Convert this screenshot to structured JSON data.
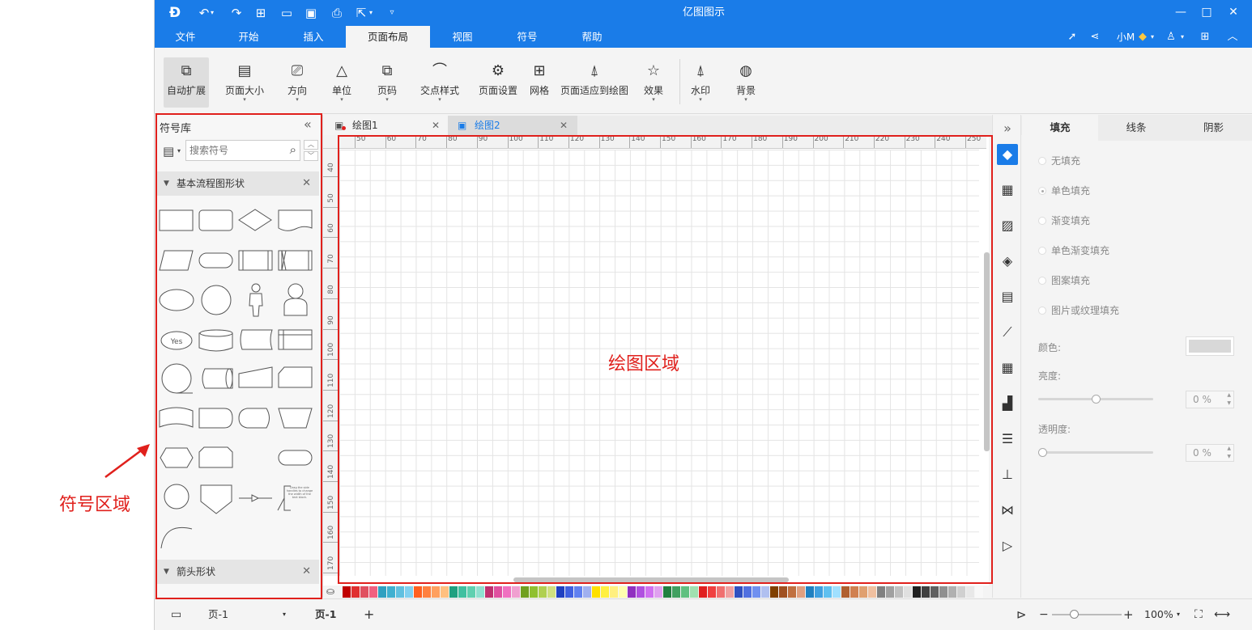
{
  "app": {
    "title": "亿图图示"
  },
  "menu": {
    "items": [
      "文件",
      "开始",
      "插入",
      "页面布局",
      "视图",
      "符号",
      "帮助"
    ],
    "active": "页面布局"
  },
  "account": {
    "user": "小M"
  },
  "ribbon": {
    "buttons": [
      {
        "label": "自动扩展",
        "icon": "auto-expand-icon",
        "has_caret": false
      },
      {
        "label": "页面大小",
        "icon": "page-size-icon",
        "has_caret": true
      },
      {
        "label": "方向",
        "icon": "orientation-icon",
        "has_caret": true
      },
      {
        "label": "单位",
        "icon": "unit-icon",
        "has_caret": true
      },
      {
        "label": "页码",
        "icon": "page-number-icon",
        "has_caret": true
      },
      {
        "label": "交点样式",
        "icon": "jump-style-icon",
        "has_caret": true
      },
      {
        "label": "页面设置",
        "icon": "page-setup-icon",
        "has_caret": false
      },
      {
        "label": "网格",
        "icon": "grid-icon",
        "has_caret": false
      },
      {
        "label": "页面适应到绘图",
        "icon": "fit-to-drawing-icon",
        "has_caret": false
      },
      {
        "label": "效果",
        "icon": "effect-icon",
        "has_caret": true
      },
      {
        "label": "水印",
        "icon": "watermark-icon",
        "has_caret": true
      },
      {
        "label": "背景",
        "icon": "background-icon",
        "has_caret": true
      }
    ]
  },
  "library": {
    "title": "符号库",
    "search_placeholder": "搜索符号",
    "sections": [
      {
        "label": "基本流程图形状"
      },
      {
        "label": "箭头形状"
      }
    ],
    "yes_shape_label": "Yes",
    "note_shape_text": "Drag the side handles to change the width of the text block."
  },
  "tabs": [
    {
      "label": "绘图1",
      "active": false
    },
    {
      "label": "绘图2",
      "active": true
    }
  ],
  "ruler": {
    "h_ticks": [
      "50",
      "60",
      "70",
      "80",
      "90",
      "100",
      "110",
      "120",
      "130",
      "140",
      "150",
      "160",
      "170",
      "180",
      "190",
      "200",
      "210",
      "220",
      "230",
      "240",
      "250"
    ],
    "v_ticks": [
      "40",
      "50",
      "60",
      "70",
      "80",
      "90",
      "100",
      "110",
      "120",
      "130",
      "140",
      "150",
      "160",
      "170"
    ]
  },
  "canvas": {
    "annotation_label": "绘图区域"
  },
  "annotation": {
    "symbol_area_label": "符号区域"
  },
  "fill_panel": {
    "tabs": [
      "填充",
      "线条",
      "阴影"
    ],
    "active_tab": "填充",
    "options": [
      "无填充",
      "单色填充",
      "渐变填充",
      "单色渐变填充",
      "图案填充",
      "图片或纹理填充"
    ],
    "selected": "单色填充",
    "color_label": "颜色:",
    "brightness_label": "亮度:",
    "brightness_value": "0 %",
    "brightness_level": 0.5,
    "transparency_label": "透明度:",
    "transparency_value": "0 %",
    "transparency_level": 0.0
  },
  "status": {
    "page_select": "页-1",
    "page_tab": "页-1",
    "add_page": "+",
    "zoom": "100%",
    "zoom_level": 0.25
  },
  "colors": {
    "accent": "#1a7ce8",
    "annotation_red": "#e0201c"
  },
  "palette": [
    "#c00000",
    "#e03030",
    "#e05060",
    "#f06080",
    "#30a0c0",
    "#40b0d0",
    "#60c0e0",
    "#80d0f0",
    "#ff6020",
    "#ff8040",
    "#ffa060",
    "#ffc080",
    "#20a080",
    "#40c0a0",
    "#60d0b0",
    "#90e0d0",
    "#c03070",
    "#e050a0",
    "#f070c0",
    "#f0a0d0",
    "#70a020",
    "#90c030",
    "#b0d050",
    "#d0e080",
    "#2040c0",
    "#4060e0",
    "#6080f0",
    "#a0b0f0",
    "#ffe000",
    "#fff040",
    "#fff080",
    "#ffffb0",
    "#9030c0",
    "#b050e0",
    "#d070f0",
    "#e0a0f0",
    "#208040",
    "#40a060",
    "#60c080",
    "#a0e0b0",
    "#e02020",
    "#f04040",
    "#f07070",
    "#f0a0a0",
    "#3050c0",
    "#5070e0",
    "#7090f0",
    "#b0c0f0",
    "#804000",
    "#a05020",
    "#c07040",
    "#e0a080",
    "#2080c0",
    "#40a0e0",
    "#60c0f0",
    "#a0e0ff",
    "#b06030",
    "#d08050",
    "#e0a070",
    "#f0c0a0",
    "#808080",
    "#a0a0a0",
    "#c0c0c0",
    "#e0e0e0",
    "#202020",
    "#404040",
    "#606060",
    "#909090",
    "#b0b0b0",
    "#d0d0d0",
    "#e8e8e8",
    "#f8f8f8"
  ]
}
